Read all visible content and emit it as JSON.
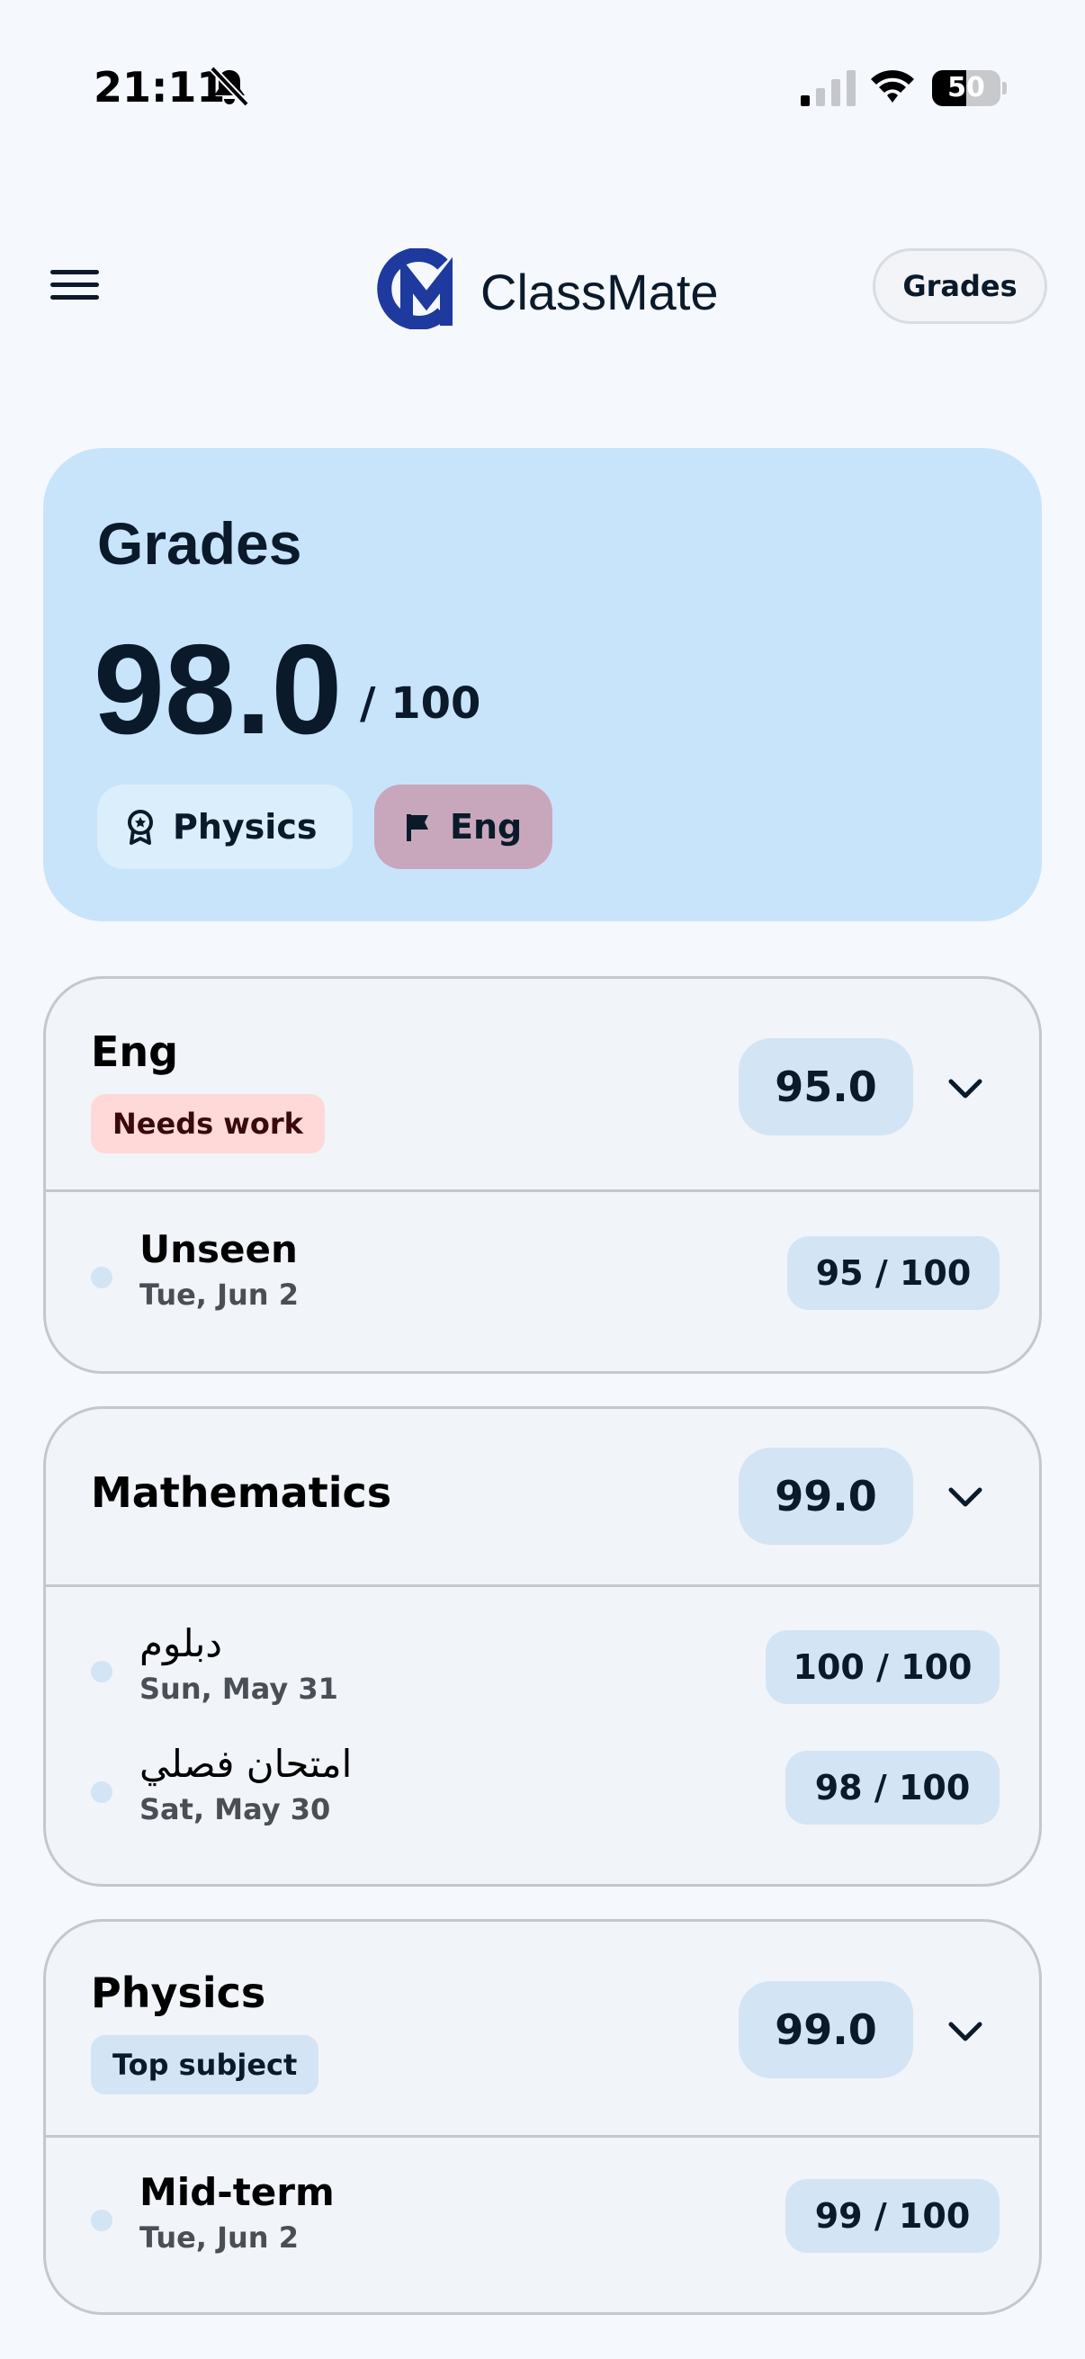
{
  "status_bar": {
    "time": "21:11",
    "battery": "50",
    "battery_level": 0.5
  },
  "header": {
    "app_title": "ClassMate",
    "menu_icon": "hamburger-menu-icon",
    "logo_icon": "classmate-cm-logo",
    "grades_button_label": "Grades"
  },
  "summary": {
    "title": "Grades",
    "score": "98.0",
    "max": "/ 100",
    "chips": [
      {
        "label": "Physics",
        "icon": "award-icon"
      },
      {
        "label": "Eng",
        "icon": "flag-icon"
      }
    ]
  },
  "subjects": [
    {
      "name": "Eng",
      "badge": "Needs work",
      "average": "95.0",
      "entries": [
        {
          "title": "Unseen",
          "date": "Tue, Jun 2",
          "score": "95 / 100"
        }
      ]
    },
    {
      "name": "Mathematics",
      "badge": "",
      "average": "99.0",
      "entries": [
        {
          "title": "دبلوم",
          "date": "Sun, May 31",
          "score": "100 / 100"
        },
        {
          "title": "امتحان فصلي",
          "date": "Sat, May 30",
          "score": "98 / 100"
        }
      ]
    },
    {
      "name": "Physics",
      "badge": "Top subject",
      "average": "99.0",
      "entries": [
        {
          "title": "Mid-term",
          "date": "Tue, Jun 2",
          "score": "99 / 100"
        }
      ]
    }
  ],
  "colors": {
    "background": "#f5f8fd",
    "summary_card": "#c8e4fb",
    "accent_blue": "#1e3a9e",
    "warn_badge": "#fed9d8",
    "eng_chip": "#c8a7bc"
  }
}
